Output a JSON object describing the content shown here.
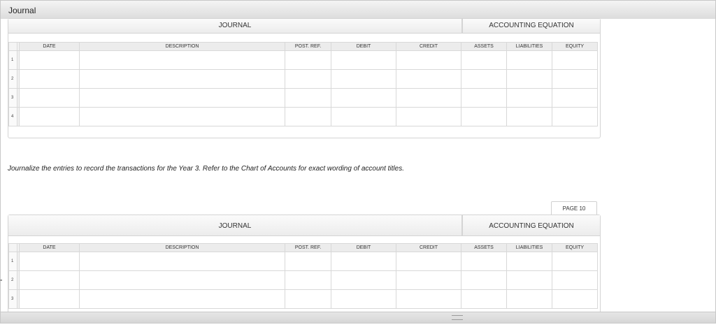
{
  "window": {
    "title": "Journal"
  },
  "journal_header": {
    "journal": "JOURNAL",
    "equation": "ACCOUNTING EQUATION"
  },
  "columns": {
    "date": "DATE",
    "description": "DESCRIPTION",
    "post_ref": "POST. REF.",
    "debit": "DEBIT",
    "credit": "CREDIT",
    "assets": "ASSETS",
    "liabilities": "LIABILITIES",
    "equity": "EQUITY"
  },
  "table1": {
    "rows": [
      "1",
      "2",
      "3",
      "4"
    ]
  },
  "instruction": "Journalize the entries to record the transactions for the Year 3. Refer to the Chart of Accounts for exact wording of account titles.",
  "page_label": "PAGE 10",
  "table2": {
    "rows": [
      "1",
      "2",
      "3"
    ]
  }
}
